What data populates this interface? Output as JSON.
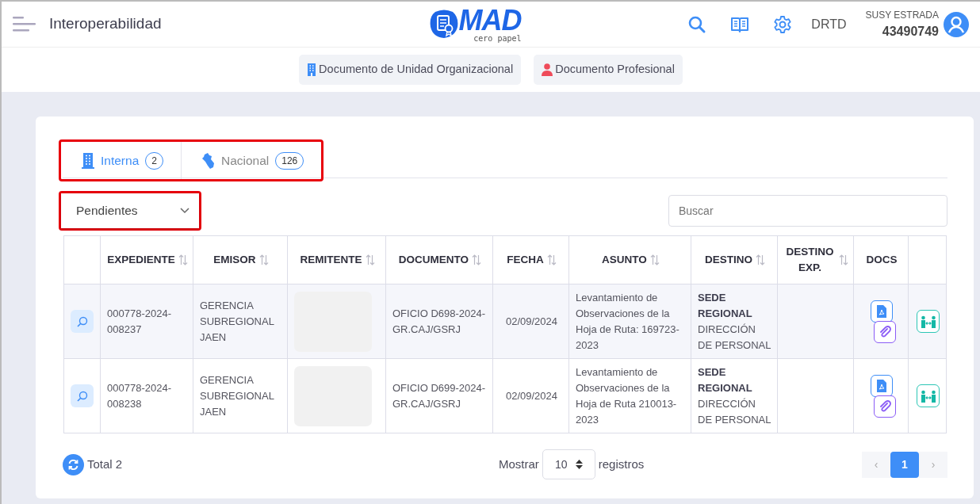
{
  "header": {
    "title": "Interoperabilidad",
    "logo_text": "MAD",
    "logo_subtitle": "cero papel",
    "office": "DRTD",
    "user_name": "SUSY ESTRADA",
    "user_id": "43490749"
  },
  "doc_buttons": [
    {
      "label": "Documento de Unidad Organizacional",
      "kind": "unit"
    },
    {
      "label": "Documento Profesional",
      "kind": "person"
    }
  ],
  "tabs": [
    {
      "label": "Interna",
      "count": "2",
      "selected": true,
      "kind": "building"
    },
    {
      "label": "Nacional",
      "count": "126",
      "selected": false,
      "kind": "map"
    }
  ],
  "filter": {
    "value": "Pendientes"
  },
  "search": {
    "placeholder": "Buscar"
  },
  "table": {
    "columns": [
      {
        "sortable": false
      },
      {
        "label": "EXPEDIENTE",
        "sortable": true
      },
      {
        "label": "EMISOR",
        "sortable": true
      },
      {
        "label": "REMITENTE",
        "sortable": true
      },
      {
        "label": "DOCUMENTO",
        "sortable": true
      },
      {
        "label": "FECHA",
        "sortable": true
      },
      {
        "label": "ASUNTO",
        "sortable": true
      },
      {
        "label": "DESTINO",
        "sortable": true
      },
      {
        "label": "DESTINO EXP.",
        "sortable": true
      },
      {
        "label": "DOCS",
        "sortable": false
      },
      {
        "sortable": false
      }
    ],
    "rows": [
      {
        "expediente": "000778-2024-008237",
        "emisor": "GERENCIA SUBREGIONAL JAEN",
        "remitente_redacted": true,
        "documento": "OFICIO D698-2024-GR.CAJ/GSRJ",
        "fecha": "02/09/2024",
        "asunto": "Levantamiento de Observaciones de la Hoja de Ruta: 169723-2023",
        "destino": "**SEDE REGIONAL** DIRECCIÓN DE PERSONAL"
      },
      {
        "expediente": "000778-2024-008238",
        "emisor": "GERENCIA SUBREGIONAL JAEN",
        "remitente_redacted": true,
        "documento": "OFICIO D699-2024-GR.CAJ/GSRJ",
        "fecha": "02/09/2024",
        "asunto": "Levantamiento de Observaciones de la Hoja de Ruta 210013-2023",
        "destino": "**SEDE REGIONAL** DIRECCIÓN DE PERSONAL"
      }
    ]
  },
  "footer": {
    "total": "Total 2",
    "show_label": "Mostrar",
    "page_size": "10",
    "records_label": "registros",
    "prev": "‹",
    "pages": [
      {
        "label": "1",
        "selected": true
      }
    ],
    "next": "›"
  }
}
